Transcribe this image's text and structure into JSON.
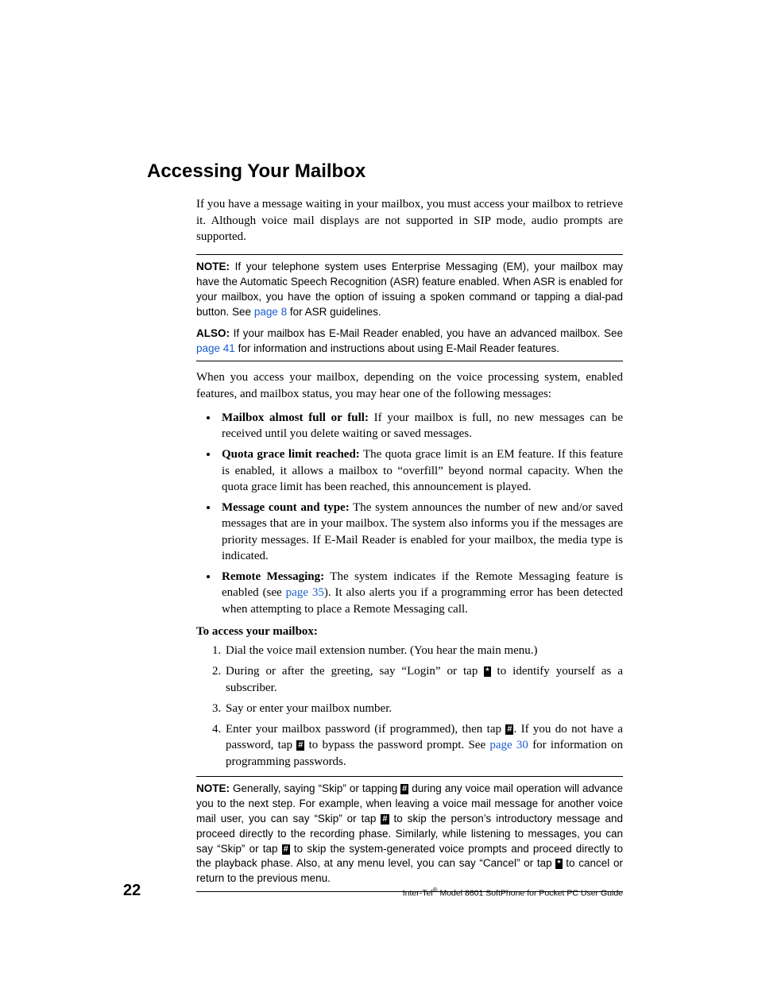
{
  "heading": "Accessing Your Mailbox",
  "intro": "If you have a message waiting in your mailbox, you must access your mailbox to retrieve it. Although voice mail displays are not supported in SIP mode, audio prompts are supported.",
  "note1": {
    "label": "NOTE:",
    "text_before_link": " If your telephone system uses Enterprise Messaging (EM), your mailbox may have the Automatic Speech Recognition (ASR) feature enabled. When ASR is enabled for your mailbox, you have the option of issuing a spoken command or tapping a dial-pad button. See ",
    "link": "page 8",
    "text_after_link": " for ASR guidelines."
  },
  "also": {
    "label": "ALSO:",
    "text_before_link": " If your mailbox has E-Mail Reader enabled, you have an advanced mailbox. See ",
    "link": "page 41",
    "text_after_link": " for information and instructions about using E-Mail Reader features."
  },
  "paragraph2": "When you access your mailbox, depending on the voice processing system, enabled features, and mailbox status, you may hear one of the following messages:",
  "bullets": [
    {
      "head": "Mailbox almost full or full:",
      "text": " If your mailbox is full, no new messages can be received until you delete waiting or saved messages."
    },
    {
      "head": "Quota grace limit reached:",
      "text": " The quota grace limit is an EM feature. If this feature is enabled, it allows a mailbox to “overfill” beyond normal capacity. When the quota grace limit has been reached, this announcement is played."
    },
    {
      "head": "Message count and type:",
      "text": " The system announces the number of new and/or saved messages that are in your mailbox. The system also informs you if the messages are priority messages. If E-Mail Reader is enabled for your mailbox, the media type is indicated."
    },
    {
      "head": "Remote Messaging:",
      "before_link": " The system indicates if the Remote Messaging feature is enabled (see ",
      "link": "page 35",
      "after_link": "). It also alerts you if a programming error has been detected when attempting to place a Remote Messaging call."
    }
  ],
  "procedure_head": "To access your mailbox:",
  "steps": {
    "s1": "Dial the voice mail extension number. (You hear the main menu.)",
    "s2_a": "During or after the greeting, say “Login” or tap ",
    "s2_b": " to identify yourself as a subscriber.",
    "s3": "Say or enter your mailbox number.",
    "s4_a": "Enter your mailbox password (if programmed), then tap ",
    "s4_b": ". If you do not have a password, tap ",
    "s4_c": " to bypass the password prompt. See ",
    "s4_link": "page 30",
    "s4_d": " for information on programming passwords."
  },
  "keys": {
    "star": "*",
    "pound": "#"
  },
  "note3": {
    "label": "NOTE:",
    "a": " Generally, saying “Skip” or tapping ",
    "b": " during any voice mail operation will advance you to the next step. For example, when leaving a voice mail message for another voice mail user, you can say “Skip” or tap ",
    "c": " to skip the person’s introductory message and proceed directly to the recording phase. Similarly, while listening to messages, you can say “Skip” or tap ",
    "d": " to skip the system-generated voice prompts and proceed directly to the playback phase. Also, at any menu level, you can say “Cancel” or tap ",
    "e": " to cancel or return to the previous menu."
  },
  "footer": {
    "page": "22",
    "guide_a": "Inter-Tel",
    "guide_sup": "®",
    "guide_b": " Model 8601 SoftPhone for Pocket PC User Guide"
  }
}
